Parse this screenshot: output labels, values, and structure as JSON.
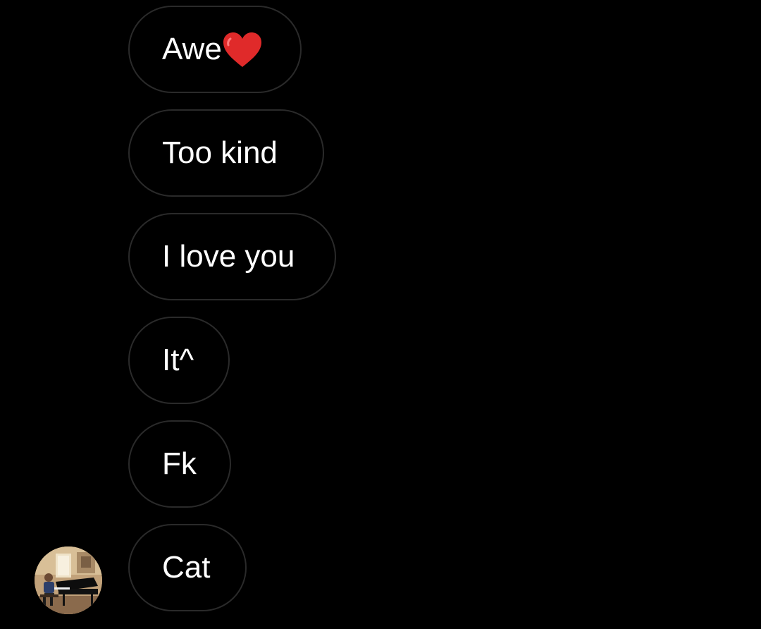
{
  "messages": [
    {
      "text": "Awe",
      "emoji": "heart-emoji"
    },
    {
      "text": "Too kind"
    },
    {
      "text": "I love you"
    },
    {
      "text": "It^"
    },
    {
      "text": "Fk"
    },
    {
      "text": "Cat"
    }
  ],
  "colors": {
    "background": "#000000",
    "bubble_border": "#2a2a2a",
    "text": "#ffffff",
    "heart": "#e02a2a"
  },
  "avatar": {
    "icon": "profile-photo-piano"
  }
}
